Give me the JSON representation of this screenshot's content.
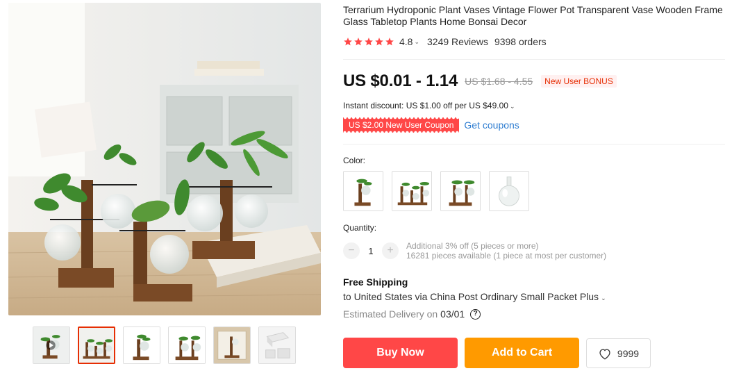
{
  "product": {
    "title": "Terrarium Hydroponic Plant Vases Vintage Flower Pot Transparent Vase Wooden Frame Glass Tabletop Plants Home Bonsai Decor",
    "rating": "4.8",
    "reviews": "3249 Reviews",
    "orders": "9398 orders",
    "star_count": 5
  },
  "price": {
    "current": "US $0.01 - 1.14",
    "original": "US $1.68 - 4.55",
    "badge": "New User BONUS"
  },
  "discount": {
    "text": "Instant discount: US $1.00 off per US $49.00"
  },
  "coupon": {
    "label": "US $2.00 New User Coupon",
    "link": "Get coupons"
  },
  "color": {
    "label": "Color:",
    "options": [
      "single-vase-frame",
      "three-vase-frame",
      "double-vase-frame",
      "glass-bulb-only"
    ]
  },
  "quantity": {
    "label": "Quantity:",
    "minus": "−",
    "plus": "+",
    "value": "1",
    "offer": "Additional 3% off (5 pieces or more)",
    "available": "16281 pieces available (1 piece at most per customer)"
  },
  "shipping": {
    "title": "Free Shipping",
    "destination": "to United States via China Post Ordinary Small Packet Plus",
    "delivery_label": "Estimated Delivery on",
    "delivery_date": "03/01",
    "help": "?"
  },
  "actions": {
    "buy": "Buy Now",
    "cart": "Add to Cart",
    "wishlist_count": "9999"
  },
  "gallery": {
    "thumbnails": [
      "video-thumb",
      "three-vase-thumb",
      "single-vase-thumb",
      "double-vase-thumb",
      "box-front-thumb",
      "packaging-thumb"
    ],
    "active_index": 1
  },
  "colors": {
    "accent": "#ff4747",
    "cart": "#ff9a00",
    "link": "#2e7dd1",
    "star": "#ff4747"
  }
}
